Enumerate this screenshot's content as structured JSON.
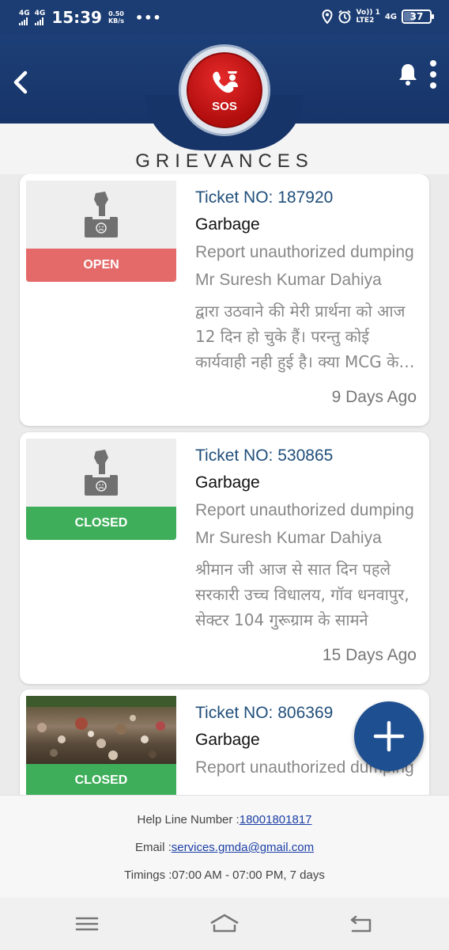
{
  "status_bar": {
    "network1": "4G",
    "network2": "4G",
    "time": "15:39",
    "speed_value": "0.50",
    "speed_unit": "KB/s",
    "overflow": "•••",
    "volte": "Vo)) 1",
    "lte": "LTE2",
    "network3": "4G",
    "battery": "37"
  },
  "header": {
    "sos_label": "SOS",
    "title": "GRIEVANCES"
  },
  "grievances": [
    {
      "ticket": "Ticket NO: 187920",
      "category": "Garbage",
      "description": "Report unauthorized dumping",
      "person": "Mr Suresh Kumar  Dahiya",
      "text": "द्वारा उठवाने की मेरी प्रार्थना को आज 12 दिन हो चुके हैं। परन्तु कोई कार्यवाही नही हुई है। क्या MCG के अधिकारी",
      "age": "9 Days Ago",
      "status": "OPEN",
      "status_color": "#e46a6a"
    },
    {
      "ticket": "Ticket NO: 530865",
      "category": "Garbage",
      "description": "Report unauthorized dumping",
      "person": "Mr Suresh Kumar  Dahiya",
      "text": "श्रीमान जी आज से सात दिन पहले सरकारी उच्च विधालय, गॉव धनवापुर, सेक्टर 104 गुरूग्राम के सामने",
      "age": "15 Days Ago",
      "status": "CLOSED",
      "status_color": "#3fae5a"
    },
    {
      "ticket": "Ticket NO: 806369",
      "category": "Garbage",
      "description": "Report unauthorized dumping",
      "status": "CLOSED",
      "status_color": "#3fae5a"
    }
  ],
  "footer": {
    "helpline_label": "Help Line Number :",
    "helpline_number": "18001801817",
    "email_label": "Email :",
    "email": "services.gmda@gmail.com",
    "timings": "Timings :07:00 AM - 07:00 PM, 7 days"
  },
  "colors": {
    "primary": "#1c3d73",
    "sos_red": "#d41c1c",
    "fab": "#1e4f90",
    "link": "#1b3fa5"
  },
  "icons": [
    "back-arrow-icon",
    "bell-icon",
    "more-vertical-icon",
    "police-phone-icon",
    "complaint-box-icon",
    "plus-icon",
    "recent-apps-icon",
    "home-icon",
    "back-nav-icon"
  ]
}
